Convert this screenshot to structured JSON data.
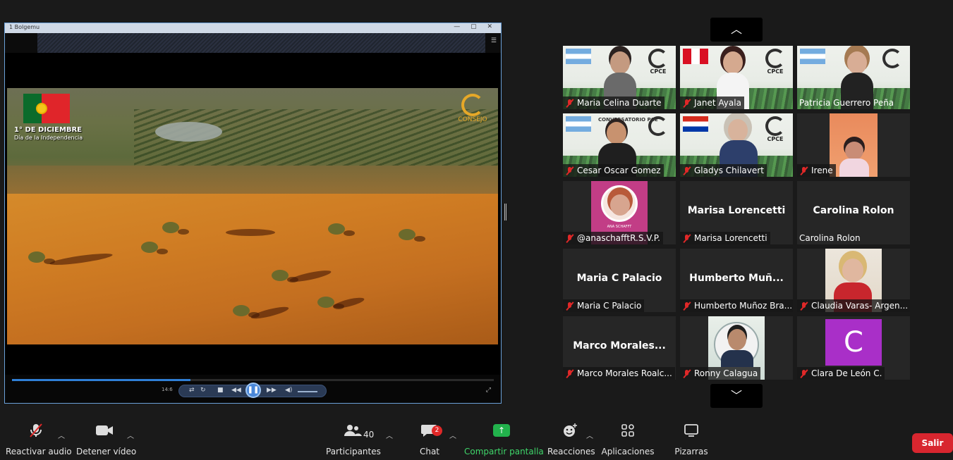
{
  "shared_screen": {
    "window_title": "1 Bolgemu",
    "video_date_line": "1° DE DICIEMBRE",
    "video_caption_line": "Día de la Independencia",
    "video_logo_text": "CONSEJO",
    "player_time": "14:6",
    "progress_fraction": 0.37
  },
  "gallery": {
    "tiles": [
      {
        "name": "Maria Celina Duarte"
      },
      {
        "name": "Janet Ayala"
      },
      {
        "name": "Patricia Guerrero Peña"
      },
      {
        "name": "Cesar Oscar Gomez"
      },
      {
        "name": "Gladys Chilavert"
      },
      {
        "name": "Irene"
      },
      {
        "name": "@anaschafftR.S.V.P.",
        "photo_caption": "ANA SCHAFFT"
      },
      {
        "name": "Marisa Lorencetti",
        "display": "Marisa Lorencetti"
      },
      {
        "name": "Carolina Rolon",
        "display": "Carolina Rolon"
      },
      {
        "name": "Maria C Palacio",
        "display": "Maria C Palacio"
      },
      {
        "name": "Humberto Muñoz Bra...",
        "display": "Humberto  Muñ..."
      },
      {
        "name": "Claudia Varas- Argen..."
      },
      {
        "name": "Marco Morales Roalc...",
        "display": "Marco  Morales..."
      },
      {
        "name": "Ronny Calagua"
      },
      {
        "name": "Clara De León C.",
        "avatar_letter": "C"
      }
    ],
    "cpce_label": "CPCE",
    "conversatorio_label": "CONVERSATORIO PCE"
  },
  "toolbar": {
    "audio_label": "Reactivar audio",
    "video_label": "Detener vídeo",
    "participants_label": "Participantes",
    "participants_count": "40",
    "chat_label": "Chat",
    "chat_badge": "2",
    "share_label": "Compartir pantalla",
    "reactions_label": "Reacciones",
    "apps_label": "Aplicaciones",
    "whiteboards_label": "Pizarras",
    "leave_label": "Salir"
  },
  "colors": {
    "accent_green": "#22b24c",
    "leave_red": "#d8262f",
    "mic_off_red": "#e02828",
    "avatar_purple": "#a92fc8"
  }
}
